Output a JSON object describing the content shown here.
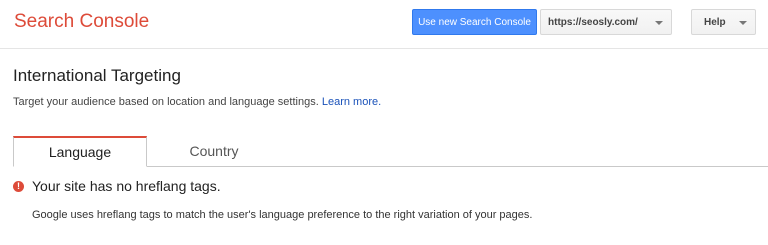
{
  "header": {
    "brand": "Search Console",
    "new_console_button": "Use new Search Console",
    "site_selector": "https://seosly.com/",
    "help_label": "Help"
  },
  "page": {
    "title": "International Targeting",
    "subtitle": "Target your audience based on location and language settings.",
    "learn_more": "Learn more."
  },
  "tabs": [
    {
      "label": "Language",
      "active": true
    },
    {
      "label": "Country",
      "active": false
    }
  ],
  "alert": {
    "icon": "!",
    "message": "Your site has no hreflang tags.",
    "description": "Google uses hreflang tags to match the user's language preference to the right variation of your pages."
  },
  "colors": {
    "brand": "#dd4b39",
    "primary_button": "#4d90fe",
    "link": "#1a52b9",
    "error": "#dd4b39"
  }
}
